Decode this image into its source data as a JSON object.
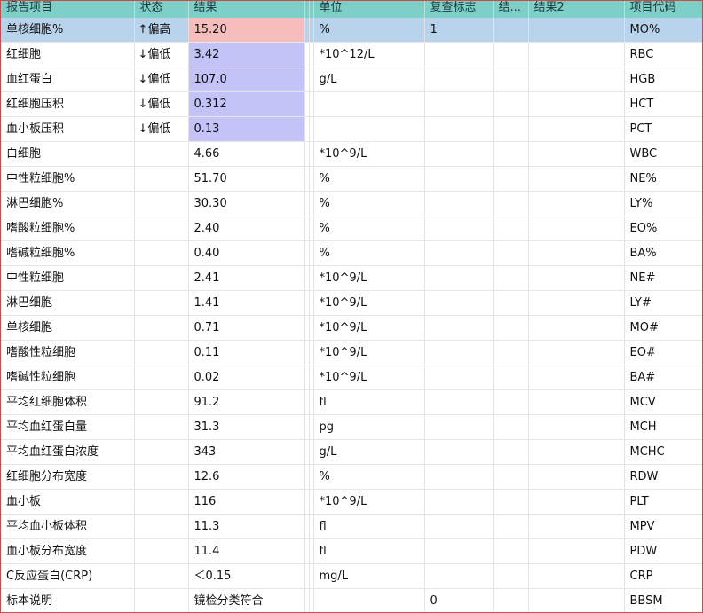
{
  "columns": [
    "报告项目",
    "状态",
    "结果",
    "",
    "",
    "单位",
    "复查标志",
    "结...",
    "结果2",
    "项目代码"
  ],
  "rows": [
    {
      "name": "单核细胞%",
      "status": "↑偏高",
      "flag": "high",
      "result": "15.20",
      "unit": "%",
      "review": "1",
      "res1": "",
      "res2": "",
      "code": "MO%",
      "selected": true
    },
    {
      "name": "红细胞",
      "status": "↓偏低",
      "flag": "low",
      "result": "3.42",
      "unit": "*10^12/L",
      "review": "",
      "res1": "",
      "res2": "",
      "code": "RBC"
    },
    {
      "name": "血红蛋白",
      "status": "↓偏低",
      "flag": "low",
      "result": "107.0",
      "unit": "g/L",
      "review": "",
      "res1": "",
      "res2": "",
      "code": "HGB"
    },
    {
      "name": "红细胞压积",
      "status": "↓偏低",
      "flag": "low",
      "result": "0.312",
      "unit": "",
      "review": "",
      "res1": "",
      "res2": "",
      "code": "HCT"
    },
    {
      "name": "血小板压积",
      "status": "↓偏低",
      "flag": "low",
      "result": "0.13",
      "unit": "",
      "review": "",
      "res1": "",
      "res2": "",
      "code": "PCT"
    },
    {
      "name": "白细胞",
      "status": "",
      "flag": "",
      "result": "4.66",
      "unit": "*10^9/L",
      "review": "",
      "res1": "",
      "res2": "",
      "code": "WBC"
    },
    {
      "name": "中性粒细胞%",
      "status": "",
      "flag": "",
      "result": "51.70",
      "unit": "%",
      "review": "",
      "res1": "",
      "res2": "",
      "code": "NE%"
    },
    {
      "name": "淋巴细胞%",
      "status": "",
      "flag": "",
      "result": "30.30",
      "unit": "%",
      "review": "",
      "res1": "",
      "res2": "",
      "code": "LY%"
    },
    {
      "name": "嗜酸粒细胞%",
      "status": "",
      "flag": "",
      "result": "2.40",
      "unit": "%",
      "review": "",
      "res1": "",
      "res2": "",
      "code": "EO%"
    },
    {
      "name": "嗜碱粒细胞%",
      "status": "",
      "flag": "",
      "result": "0.40",
      "unit": "%",
      "review": "",
      "res1": "",
      "res2": "",
      "code": "BA%"
    },
    {
      "name": "中性粒细胞",
      "status": "",
      "flag": "",
      "result": "2.41",
      "unit": "*10^9/L",
      "review": "",
      "res1": "",
      "res2": "",
      "code": "NE#"
    },
    {
      "name": "淋巴细胞",
      "status": "",
      "flag": "",
      "result": "1.41",
      "unit": "*10^9/L",
      "review": "",
      "res1": "",
      "res2": "",
      "code": "LY#"
    },
    {
      "name": "单核细胞",
      "status": "",
      "flag": "",
      "result": "0.71",
      "unit": "*10^9/L",
      "review": "",
      "res1": "",
      "res2": "",
      "code": "MO#"
    },
    {
      "name": "嗜酸性粒细胞",
      "status": "",
      "flag": "",
      "result": "0.11",
      "unit": "*10^9/L",
      "review": "",
      "res1": "",
      "res2": "",
      "code": "EO#"
    },
    {
      "name": "嗜碱性粒细胞",
      "status": "",
      "flag": "",
      "result": "0.02",
      "unit": "*10^9/L",
      "review": "",
      "res1": "",
      "res2": "",
      "code": "BA#"
    },
    {
      "name": "平均红细胞体积",
      "status": "",
      "flag": "",
      "result": "91.2",
      "unit": "fl",
      "review": "",
      "res1": "",
      "res2": "",
      "code": "MCV"
    },
    {
      "name": "平均血红蛋白量",
      "status": "",
      "flag": "",
      "result": "31.3",
      "unit": "pg",
      "review": "",
      "res1": "",
      "res2": "",
      "code": "MCH"
    },
    {
      "name": "平均血红蛋白浓度",
      "status": "",
      "flag": "",
      "result": "343",
      "unit": "g/L",
      "review": "",
      "res1": "",
      "res2": "",
      "code": "MCHC"
    },
    {
      "name": "红细胞分布宽度",
      "status": "",
      "flag": "",
      "result": "12.6",
      "unit": "%",
      "review": "",
      "res1": "",
      "res2": "",
      "code": "RDW"
    },
    {
      "name": "血小板",
      "status": "",
      "flag": "",
      "result": "116",
      "unit": "*10^9/L",
      "review": "",
      "res1": "",
      "res2": "",
      "code": "PLT"
    },
    {
      "name": "平均血小板体积",
      "status": "",
      "flag": "",
      "result": "11.3",
      "unit": "fl",
      "review": "",
      "res1": "",
      "res2": "",
      "code": "MPV"
    },
    {
      "name": "血小板分布宽度",
      "status": "",
      "flag": "",
      "result": "11.4",
      "unit": "fl",
      "review": "",
      "res1": "",
      "res2": "",
      "code": "PDW"
    },
    {
      "name": "C反应蛋白(CRP)",
      "status": "",
      "flag": "",
      "result": "＜0.15",
      "unit": "mg/L",
      "review": "",
      "res1": "",
      "res2": "",
      "code": "CRP"
    },
    {
      "name": "标本说明",
      "status": "",
      "flag": "",
      "result": "镜检分类符合",
      "unit": "",
      "review": "0",
      "res1": "",
      "res2": "",
      "code": "BBSM"
    }
  ],
  "colors": {
    "header_bg": "#7fcfc9",
    "selected_row_bg": "#bad3ec",
    "high_result_bg": "#f6bdbd",
    "low_result_bg": "#c3c3f7",
    "frame_border": "#d04848"
  }
}
